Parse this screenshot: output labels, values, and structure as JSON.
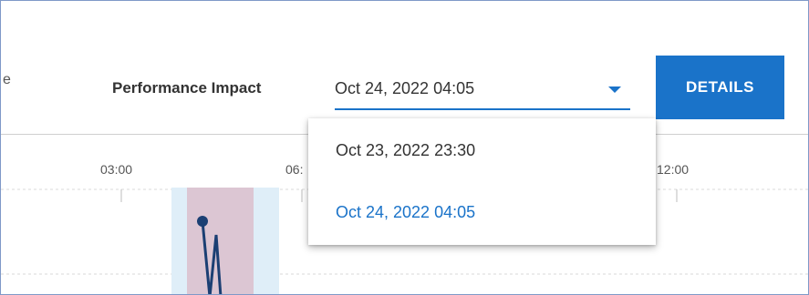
{
  "header": {
    "cut_text": "e",
    "performance_label": "Performance Impact",
    "details_label": "DETAILS"
  },
  "select": {
    "value": "Oct 24, 2022 04:05",
    "options": [
      "Oct 23, 2022 23:30",
      "Oct 24, 2022 04:05"
    ],
    "selected_index": 1
  },
  "chart_data": {
    "type": "line",
    "x_tick_labels": [
      "03:00",
      "06:",
      "12:00"
    ]
  },
  "colors": {
    "accent": "#1a73c9",
    "highlight_band": "#dfeef8",
    "impact_band": "#dcc6d3",
    "line": "#1b3f73"
  },
  "icons": {
    "dropdown": "chevron-down-icon"
  }
}
